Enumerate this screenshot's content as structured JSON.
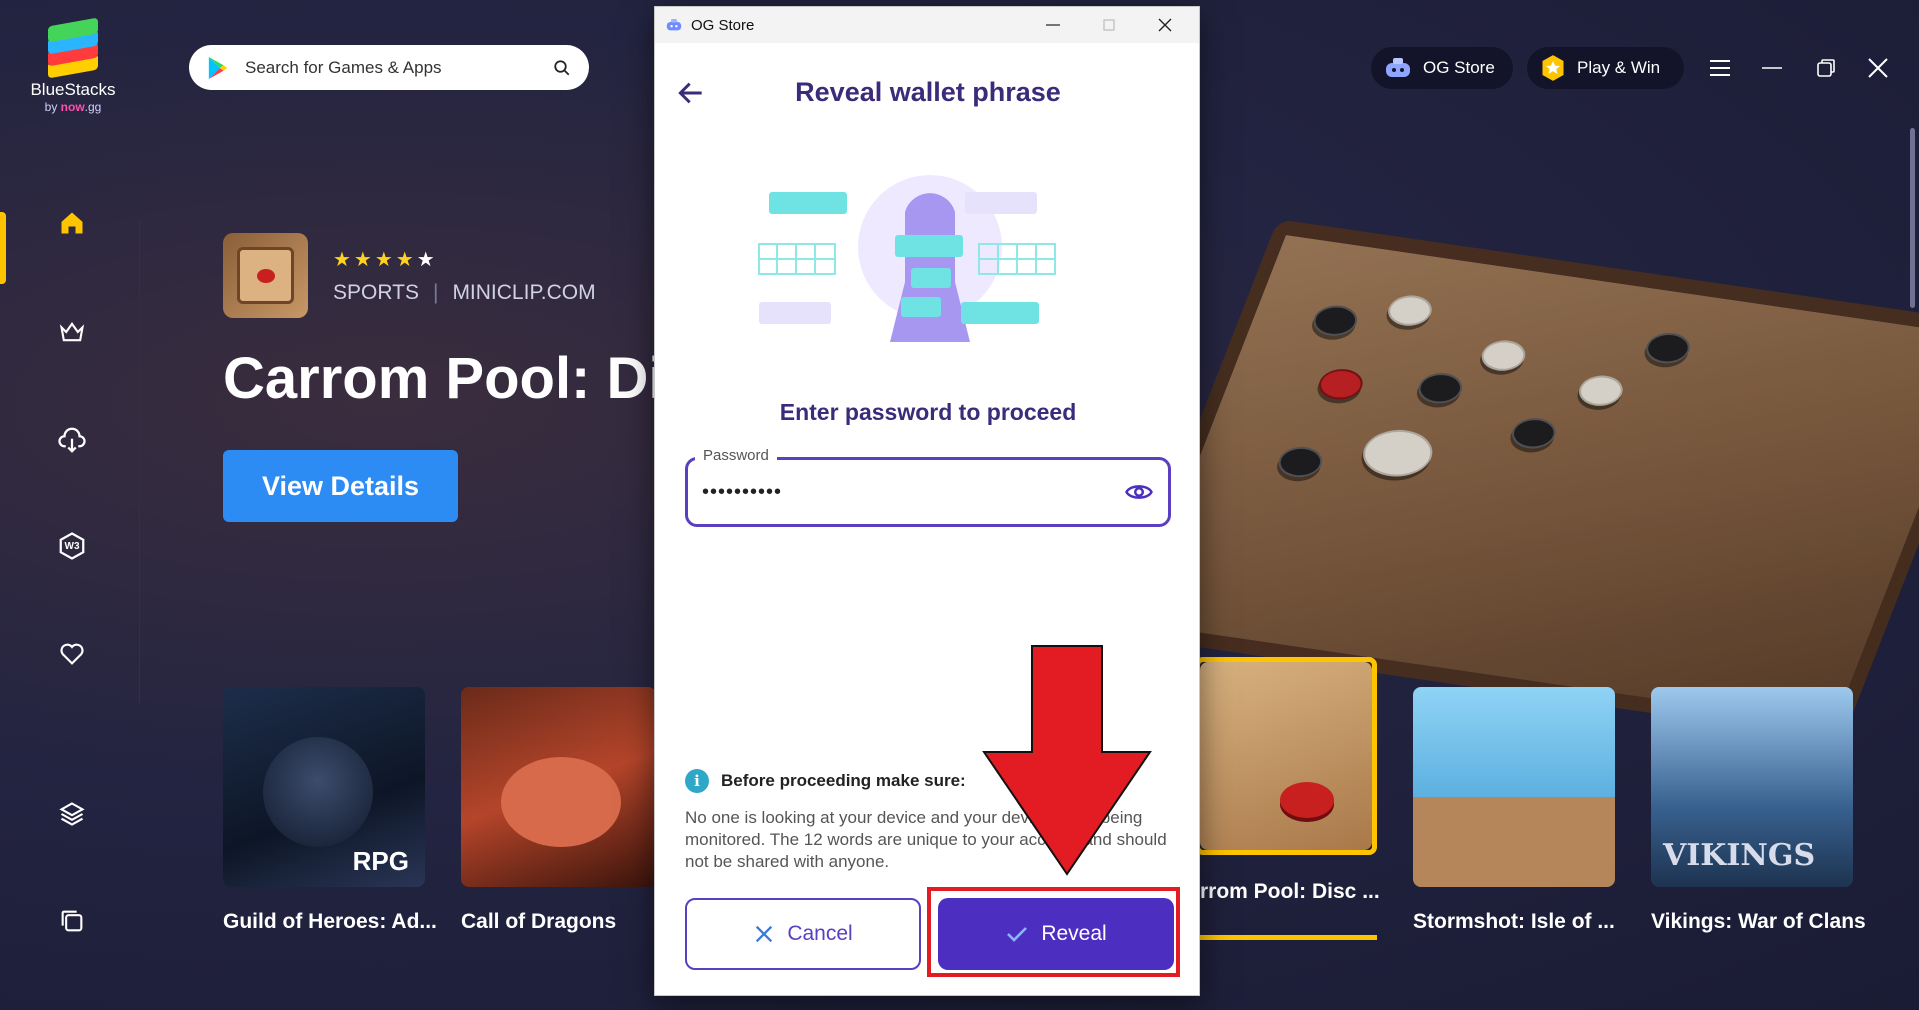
{
  "brand": {
    "name": "BlueStacks",
    "by": "by",
    "sub": "now",
    "suffix": ".gg"
  },
  "search": {
    "placeholder": "Search for Games & Apps"
  },
  "header": {
    "og_store_label": "OG Store",
    "play_win_label": "Play & Win"
  },
  "sidebar": {
    "items": [
      {
        "name": "home",
        "icon": "home-icon"
      },
      {
        "name": "crown",
        "icon": "crown-icon"
      },
      {
        "name": "cloud",
        "icon": "cloud-download-icon"
      },
      {
        "name": "web3",
        "icon": "w3-icon",
        "text": "W3"
      },
      {
        "name": "favorites",
        "icon": "heart-icon"
      },
      {
        "name": "layers",
        "icon": "layers-icon"
      },
      {
        "name": "multi-instance",
        "icon": "multi-window-icon"
      }
    ]
  },
  "featured": {
    "rating": 4.5,
    "genre": "SPORTS",
    "publisher": "MINICLIP.COM",
    "title": "Carrom Pool: Dis",
    "cta": "View Details"
  },
  "games": [
    {
      "label": "Guild of Heroes: Ad...",
      "badge": "RPG"
    },
    {
      "label": "Call of Dragons"
    },
    {
      "label": "rrom Pool: Disc ..."
    },
    {
      "label": "Stormshot: Isle of ..."
    },
    {
      "label": "Vikings: War of Clans",
      "badge": "VIKINGS"
    }
  ],
  "dialog": {
    "window_title": "OG Store",
    "heading": "Reveal wallet phrase",
    "prompt": "Enter password to proceed",
    "password_label": "Password",
    "password_value": "••••••••••",
    "notice_title": "Before proceeding make sure:",
    "notice_body": "No one is looking at your device and your device is not being monitored. The 12 words are unique to your account and should not be shared with anyone.",
    "cancel_label": "Cancel",
    "reveal_label": "Reveal"
  },
  "colors": {
    "accent": "#4c2ec0",
    "heading": "#3b2b7a",
    "highlight": "#e31b23",
    "active_nav": "#ffc400",
    "cta_blue": "#2d8cf3"
  }
}
